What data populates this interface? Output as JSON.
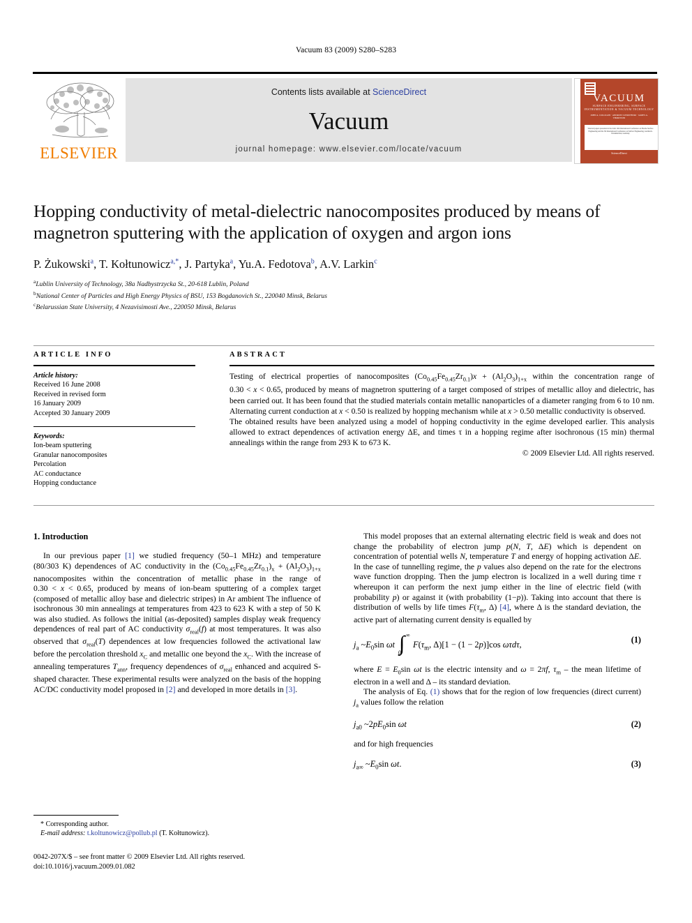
{
  "running_head": "Vacuum 83 (2009) S280–S283",
  "masthead": {
    "contents_prefix": "Contents lists available at ",
    "sciencedirect": "ScienceDirect",
    "journal_name": "Vacuum",
    "homepage": "journal homepage: www.elsevier.com/locate/vacuum",
    "publisher_logo_text": "ELSEVIER",
    "cover": {
      "title": "VACUUM",
      "subtitle": "SURFACE ENGINEERING, SURFACE INSTRUMENTATION & VACUUM TECHNOLOGY",
      "authors_line": "JOHN A. COLLIGON   ·   ANDRZEJ CZERWINSKI   ·   JAMES A. THORNTON",
      "abstract_text": "Selected papers presented at the Joint 12th International Conference on Plasma Surface Engineering and the 5th International Conference on Surface Engineering, Garmisch-Partenkirchen, Germany",
      "sciencedirect": "ScienceDirect"
    },
    "accent_orange": "#f07d00",
    "link_blue": "#2b3fa0",
    "panel_gray": "#e3e3e3",
    "cover_red": "#b4462a"
  },
  "title": "Hopping conductivity of metal-dielectric nanocomposites produced by means of magnetron sputtering with the application of oxygen and argon ions",
  "authors": [
    {
      "name": "P. Żukowski",
      "marks": "a"
    },
    {
      "name": "T. Kołtunowicz",
      "marks": "a,*"
    },
    {
      "name": "J. Partyka",
      "marks": "a"
    },
    {
      "name": "Yu.A. Fedotova",
      "marks": "b"
    },
    {
      "name": "A.V. Larkin",
      "marks": "c"
    }
  ],
  "affiliations": [
    {
      "mark": "a",
      "text": "Lublin University of Technology, 38a Nadbystrzycka St., 20-618 Lublin, Poland"
    },
    {
      "mark": "b",
      "text": "National Center of Particles and High Energy Physics of BSU, 153 Bogdanovich St., 220040 Minsk, Belarus"
    },
    {
      "mark": "c",
      "text": "Belarussian State University, 4 Nezavisimosti Ave., 220050 Minsk, Belarus"
    }
  ],
  "article_info": {
    "heading": "ARTICLE INFO",
    "history_label": "Article history:",
    "history": [
      "Received 16 June 2008",
      "Received in revised form",
      "16 January 2009",
      "Accepted 30 January 2009"
    ],
    "keywords_label": "Keywords:",
    "keywords": [
      "Ion-beam sputtering",
      "Granular nanocomposites",
      "Percolation",
      "AC conductance",
      "Hopping conductance"
    ]
  },
  "abstract": {
    "heading": "ABSTRACT",
    "paragraph1_a": "Testing of electrical properties of nanocomposites (Co",
    "paragraph1_full": "Testing of electrical properties of nanocomposites (Co0.45Fe0.45Zr0.1)x + (Al2O3)1+x within the concentration range of 0.30 < x < 0.65, produced by means of magnetron sputtering of a target composed of stripes of metallic alloy and dielectric, has been carried out. It has been found that the studied materials contain metallic nanoparticles of a diameter ranging from 6 to 10 nm. Alternating current conduction at x < 0.50 is realized by hopping mechanism while at x > 0.50 metallic conductivity is observed.",
    "paragraph2": "The obtained results have been analyzed using a model of hopping conductivity in the egime developed earlier. This analysis allowed to extract dependences of activation energy ΔE, and times τ in a hopping regime after isochronous (15 min) thermal annealings within the range from 293 K to 673 K.",
    "copyright": "© 2009 Elsevier Ltd. All rights reserved."
  },
  "section1": {
    "heading": "1. Introduction",
    "p1_full": "In our previous paper [1] we studied frequency (50–1 MHz) and temperature (80/303 K) dependences of AC conductivity in the (Co0.45Fe0.45Zr0.1)x + (Al2O3)1+x nanocomposites within the concentration of metallic phase in the range of 0.30 < x < 0.65, produced by means of ion-beam sputtering of a complex target (composed of metallic alloy base and dielectric stripes) in Ar ambient The influence of isochronous 30 min annealings at temperatures from 423 to 623 K with a step of 50 K was also studied. As follows the initial (as-deposited) samples display weak frequency dependences of real part of AC conductivity σreal(f) at most temperatures. It was also observed that σreal(T) dependences at low frequencies followed the activational law before the percolation threshold xC and metallic one beyond the xC. With the increase of annealing temperatures Tann, frequency dependences of σreal enhanced and acquired S-shaped character. These experimental results were analyzed on the basis of the hopping AC/DC conductivity model proposed in [2] and developed in more details in [3]."
  },
  "right_column": {
    "p1_full": "This model proposes that an external alternating electric field is weak and does not change the probability of electron jump p(N, T, ΔE) which is dependent on concentration of potential wells N, temperature T and energy of hopping activation ΔE. In the case of tunnelling regime, the p values also depend on the rate for the electrons wave function dropping. Then the jump electron is localized in a well during time τ whereupon it can perform the next jump either in the line of electric field (with probability p) or against it (with probability (1−p)). Taking into account that there is distribution of wells by life times F(τm, Δ) [4], where Δ is the standard deviation, the active part of alternating current density is equalled by",
    "eq1_number": "(1)",
    "eq1_text": "ja ~E0sin ωt ∫0∞ F(τm, Δ)[1 − (1 − 2p)]cos ωτdτ,",
    "after_eq1_full": "where E = E0sin ωt is the electric intensity and ω = 2πf, τm – the mean lifetime of electron in a well and Δ – its standard deviation.",
    "p2_full": "The analysis of Eq. (1) shows that for the region of low frequencies (direct current) ja values follow the relation",
    "eq2_number": "(2)",
    "eq2_text": "ja0 ~2pE0sin ωt",
    "between_text": "and for high frequencies",
    "eq3_number": "(3)",
    "eq3_text": "ja∞ ~E0sin ωt."
  },
  "footnote": {
    "corresponding": "* Corresponding author.",
    "email_label": "E-mail address:",
    "email": "t.koltunowicz@pollub.pl",
    "email_owner": "(T. Kołtunowicz)."
  },
  "colophon": {
    "line1": "0042-207X/$ – see front matter © 2009 Elsevier Ltd. All rights reserved.",
    "line2": "doi:10.1016/j.vacuum.2009.01.082"
  }
}
